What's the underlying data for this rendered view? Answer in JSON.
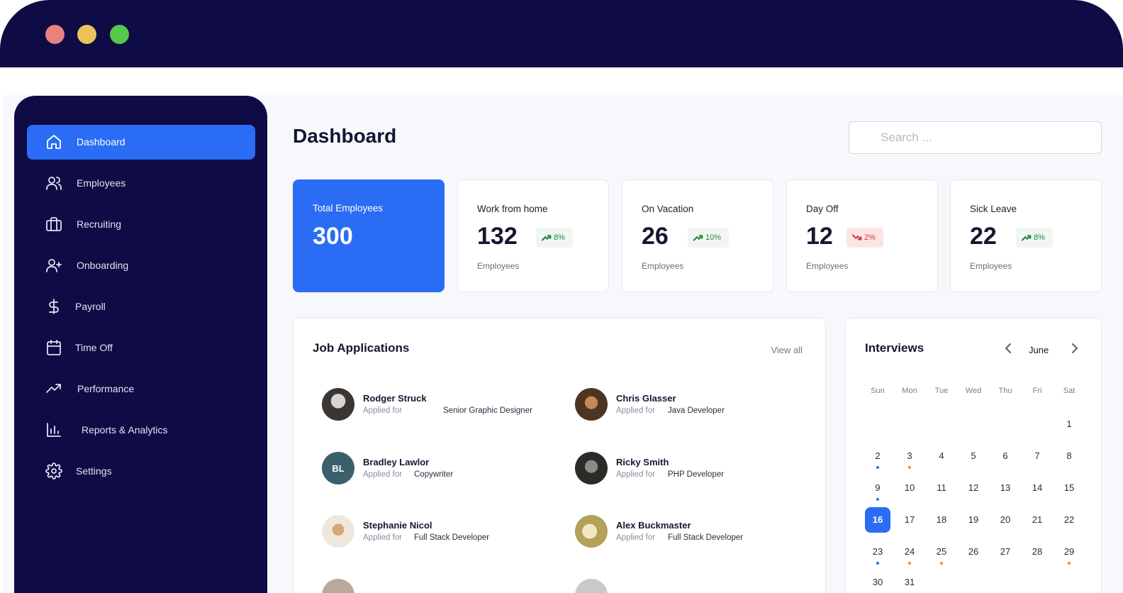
{
  "window": {
    "controls": [
      "close",
      "minimize",
      "maximize"
    ]
  },
  "sidebar": {
    "items": [
      {
        "label": "Dashboard",
        "icon": "home-icon",
        "active": true
      },
      {
        "label": "Employees",
        "icon": "users-icon",
        "active": false
      },
      {
        "label": "Recruiting",
        "icon": "briefcase-icon",
        "active": false
      },
      {
        "label": "Onboarding",
        "icon": "user-plus-icon",
        "active": false
      },
      {
        "label": "Payroll",
        "icon": "dollar-icon",
        "active": false
      },
      {
        "label": "Time Off",
        "icon": "calendar-icon",
        "active": false
      },
      {
        "label": "Performance",
        "icon": "trending-up-icon",
        "active": false
      },
      {
        "label": "Reports & Analytics",
        "icon": "bar-chart-icon",
        "active": false
      },
      {
        "label": "Settings",
        "icon": "gear-icon",
        "active": false
      }
    ]
  },
  "header": {
    "title": "Dashboard",
    "search_placeholder": "Search ..."
  },
  "stats": [
    {
      "label": "Total Employees",
      "value": "300"
    },
    {
      "label": "Work from home",
      "value": "132",
      "change": "8%",
      "trend": "up",
      "sub": "Employees"
    },
    {
      "label": "On Vacation",
      "value": "26",
      "change": "10%",
      "trend": "up",
      "sub": "Employees"
    },
    {
      "label": "Day Off",
      "value": "12",
      "change": "2%",
      "trend": "down",
      "sub": "Employees"
    },
    {
      "label": "Sick Leave",
      "value": "22",
      "change": "8%",
      "trend": "up",
      "sub": "Employees"
    }
  ],
  "job_applications": {
    "title": "Job Applications",
    "view_all": "View all",
    "applied_label": "Applied for",
    "items": [
      {
        "name": "Rodger Struck",
        "role": "Senior Graphic Designer",
        "avatar": "photo"
      },
      {
        "name": "Chris Glasser",
        "role": "Java Developer",
        "avatar": "photo"
      },
      {
        "name": "Bradley Lawlor",
        "role": "Copywriter",
        "avatar": "initials",
        "initials": "BL"
      },
      {
        "name": "Ricky Smith",
        "role": "PHP Developer",
        "avatar": "photo"
      },
      {
        "name": "Stephanie Nicol",
        "role": "Full Stack Developer",
        "avatar": "photo"
      },
      {
        "name": "Alex Buckmaster",
        "role": "Full Stack Developer",
        "avatar": "photo"
      }
    ]
  },
  "interviews": {
    "title": "Interviews",
    "month": "June",
    "weekdays": [
      "Sun",
      "Mon",
      "Tue",
      "Wed",
      "Thu",
      "Fri",
      "Sat"
    ],
    "first_weekday": 6,
    "days": [
      "1",
      "2",
      "3",
      "4",
      "5",
      "6",
      "7",
      "8",
      "9",
      "10",
      "11",
      "12",
      "13",
      "14",
      "15",
      "16",
      "17",
      "18",
      "19",
      "20",
      "21",
      "22",
      "23",
      "24",
      "25",
      "26",
      "27",
      "28",
      "29",
      "30",
      "31"
    ],
    "selected": "16",
    "event_dots": [
      {
        "day": "2",
        "color": "#2a6df4"
      },
      {
        "day": "3",
        "color": "#f08c3a"
      },
      {
        "day": "9",
        "color": "#2a6df4"
      },
      {
        "day": "23",
        "color": "#2a6df4"
      },
      {
        "day": "24",
        "color": "#f08c3a"
      },
      {
        "day": "25",
        "color": "#f08c3a"
      },
      {
        "day": "29",
        "color": "#f08c3a"
      }
    ]
  },
  "colors": {
    "sidebar_bg": "#0e0b45",
    "accent": "#2a6df4",
    "up": "#1f8a3a",
    "down": "#d43b3b"
  }
}
